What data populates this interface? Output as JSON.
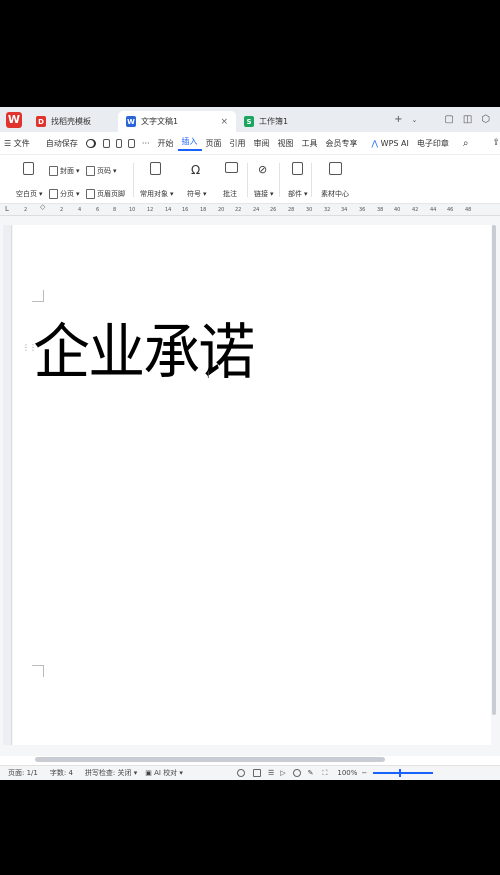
{
  "tabs": [
    {
      "label": "找稻壳模板",
      "icon": "D",
      "color": "#e0332e"
    },
    {
      "label": "文字文稿1",
      "icon": "W",
      "color": "#2b66d9"
    },
    {
      "label": "工作簿1",
      "icon": "S",
      "color": "#1ba660"
    }
  ],
  "menu": {
    "file": "文件",
    "autosave": "自动保存",
    "items": [
      "开始",
      "插入",
      "页面",
      "引用",
      "审阅",
      "视图",
      "工具",
      "会员专享"
    ],
    "active": "插入",
    "wps_ai": "WPS AI",
    "seal": "电子印章"
  },
  "ribbon": {
    "blank_page": "空白页",
    "cover": "封面",
    "page_break": "分页",
    "page_number": "页码",
    "header_footer": "页眉页脚",
    "common_objects": "常用对象",
    "symbol": "符号",
    "comment": "批注",
    "link": "链接",
    "parts": "部件",
    "materials": "素材中心"
  },
  "ruler_ticks": [
    "2",
    "2",
    "4",
    "6",
    "8",
    "10",
    "12",
    "14",
    "16",
    "18",
    "20",
    "22",
    "24",
    "26",
    "28",
    "30",
    "32",
    "34",
    "36",
    "38",
    "40",
    "42",
    "44",
    "46",
    "48"
  ],
  "document": {
    "title_text": "企业承诺"
  },
  "status": {
    "page": "页面: 1/1",
    "word_count": "字数: 4",
    "spell_check": "拼写检查: 关闭",
    "ai_check": "AI 校对",
    "zoom": "100%"
  },
  "colors": {
    "accent": "#1a62ff",
    "wps_red": "#e0332e"
  }
}
